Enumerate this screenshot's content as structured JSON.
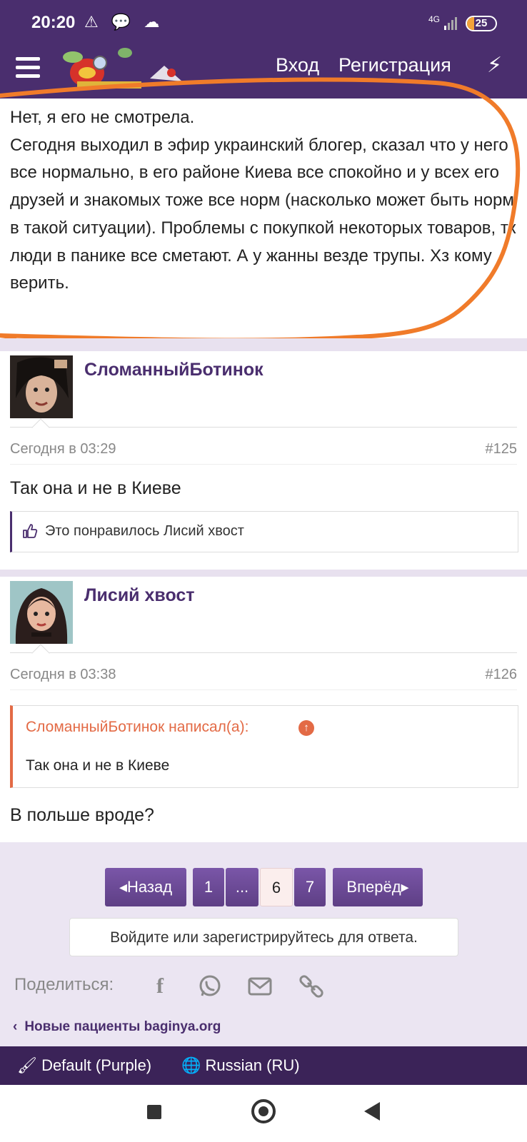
{
  "status_bar": {
    "time": "20:20",
    "network": "4G",
    "battery": "25",
    "battery_level": 0.25
  },
  "nav": {
    "login": "Вход",
    "register": "Регистрация"
  },
  "first_post": {
    "text": "Нет, я его не смотрела.\nСегодня выходил в эфир украинский блогер, сказал что у него все нормально, в его районе Киева все спокойно и у всех его друзей и знакомых тоже все норм (насколько может быть норм в такой ситуации). Проблемы с покупкой некоторых товаров, тк люди в панике все сметают. А у жанны везде трупы. Хз кому верить."
  },
  "posts": [
    {
      "author": "СломанныйБотинок",
      "date": "Сегодня в 03:29",
      "number": "#125",
      "body": "Так она и не в Киеве",
      "likes": "Это понравилось Лисий хвост"
    },
    {
      "author": "Лисий хвост",
      "date": "Сегодня в 03:38",
      "number": "#126",
      "quote_author": "СломанныйБотинок написал(а):",
      "quote_text": "Так она и не в Киеве",
      "body": "В польше вроде?"
    }
  ],
  "pagination": {
    "prev": "◂Назад",
    "page1": "1",
    "ellipsis": "...",
    "page6": "6",
    "page7": "7",
    "next": "Вперёд▸"
  },
  "reply_prompt": "Войдите или зарегистрируйтесь для ответа.",
  "share": {
    "label": "Поделиться:",
    "icons": [
      "facebook-icon",
      "whatsapp-icon",
      "mail-icon",
      "link-icon"
    ]
  },
  "breadcrumb": "Новые пациенты baginya.org",
  "footer": {
    "style": "Default (Purple)",
    "language": "Russian (RU)"
  },
  "colors": {
    "brand": "#4a2e6e",
    "accent_orange": "#e36a45"
  }
}
